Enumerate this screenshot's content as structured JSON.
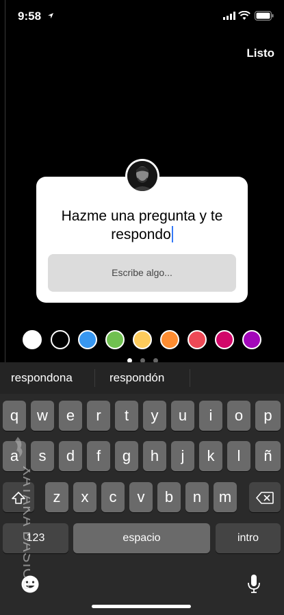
{
  "status_bar": {
    "time": "9:58"
  },
  "header": {
    "done_label": "Listo"
  },
  "question_card": {
    "line1": "Hazme una pregunta y te",
    "line2": "respondo",
    "answer_placeholder": "Escribe algo..."
  },
  "color_palette": [
    "#ffffff",
    "#000000",
    "#3897f0",
    "#70c050",
    "#fdcb5c",
    "#fd8d32",
    "#ed4956",
    "#d10869",
    "#a307ba"
  ],
  "page_dots": {
    "count": 3,
    "active_index": 0
  },
  "suggestions": [
    "respondona",
    "respondón"
  ],
  "keyboard": {
    "row1": [
      "q",
      "w",
      "e",
      "r",
      "t",
      "y",
      "u",
      "i",
      "o",
      "p"
    ],
    "row2": [
      "a",
      "s",
      "d",
      "f",
      "g",
      "h",
      "j",
      "k",
      "l",
      "ñ"
    ],
    "row3": [
      "z",
      "x",
      "c",
      "v",
      "b",
      "n",
      "m"
    ],
    "numbers_label": "123",
    "space_label": "espacio",
    "return_label": "intro"
  },
  "watermark": {
    "text": "XATAKA BASICS"
  }
}
